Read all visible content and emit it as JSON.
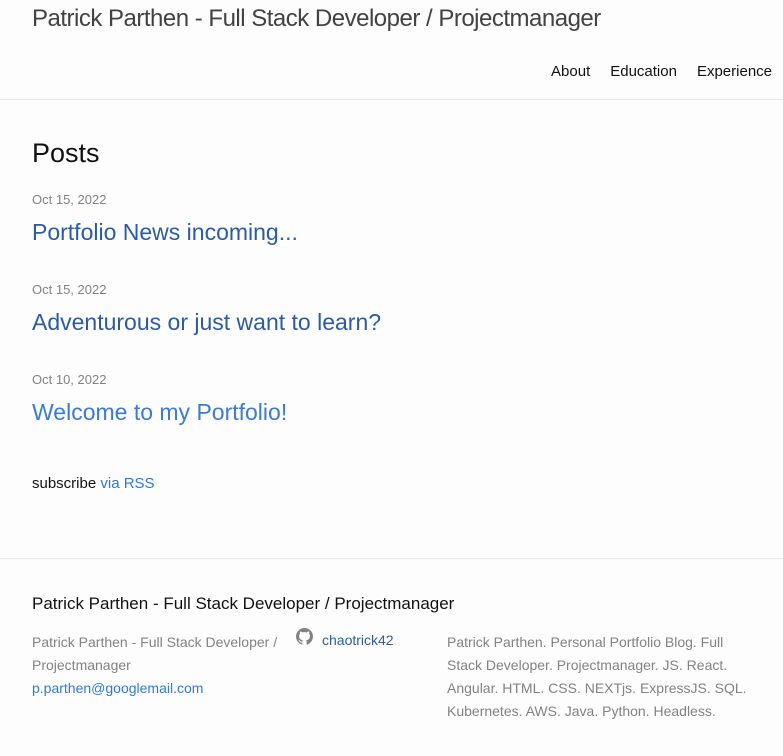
{
  "header": {
    "site_title": "Patrick Parthen - Full Stack Developer / Projectmanager",
    "nav": [
      {
        "label": "About"
      },
      {
        "label": "Education"
      },
      {
        "label": "Experience"
      }
    ]
  },
  "main": {
    "heading": "Posts",
    "posts": [
      {
        "date": "Oct 15, 2022",
        "title": "Portfolio News incoming..."
      },
      {
        "date": "Oct 15, 2022",
        "title": "Adventurous or just want to learn?"
      },
      {
        "date": "Oct 10, 2022",
        "title": "Welcome to my Portfolio!"
      }
    ],
    "subscribe_text": "subscribe",
    "rss_link": "via RSS"
  },
  "footer": {
    "heading": "Patrick Parthen - Full Stack Developer / Projectmanager",
    "col1_text": "Patrick Parthen - Full Stack Developer / Projectmanager",
    "email": "p.parthen@googlemail.com",
    "github_username": "chaotrick42",
    "description": "Patrick Parthen. Personal Portfolio Blog. Full Stack Developer. Projectmanager. JS. React. Angular. HTML. CSS. NEXTjs. ExpressJS. SQL. Kubernetes. AWS. Java. Python. Headless."
  },
  "icons": {
    "github": "github-icon"
  },
  "colors": {
    "link": "#2a7ae2",
    "post_link": "#2a5ba8",
    "meta": "#828282"
  }
}
